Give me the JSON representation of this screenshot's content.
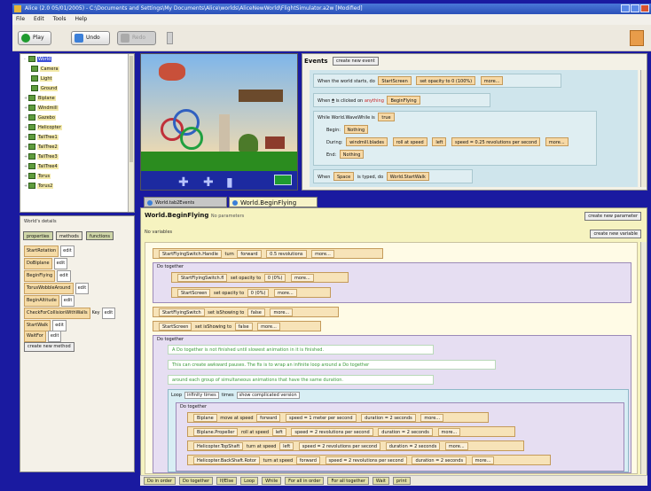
{
  "window": {
    "title": "Alice (2.0 05/01/2005) - C:\\Documents and Settings\\My Documents\\Alice\\worlds\\AliceNewWorld\\FlightSimulator.a2w [Modified]"
  },
  "menu": [
    "File",
    "Edit",
    "Tools",
    "Help"
  ],
  "toolbar": {
    "play": "Play",
    "undo": "Undo",
    "redo": "Redo"
  },
  "tree": [
    {
      "label": "World",
      "selected": true
    },
    {
      "label": "Camera"
    },
    {
      "label": "Light"
    },
    {
      "label": "Ground"
    },
    {
      "label": "Biplane"
    },
    {
      "label": "Windmill"
    },
    {
      "label": "Gazebo"
    },
    {
      "label": "Helicopter"
    },
    {
      "label": "TallTree1"
    },
    {
      "label": "TallTree2"
    },
    {
      "label": "TallTree3"
    },
    {
      "label": "TallTree4"
    },
    {
      "label": "Torus"
    },
    {
      "label": "Torus2"
    }
  ],
  "details": {
    "title": "World's details",
    "tabs": [
      "properties",
      "methods",
      "functions"
    ],
    "methods": [
      {
        "name": "StartRotation",
        "edit": "edit"
      },
      {
        "name": "DoBiplane",
        "edit": "edit"
      },
      {
        "name": "BeginFlying",
        "edit": "edit"
      },
      {
        "name": "TorusWobbleAround",
        "edit": "edit"
      },
      {
        "name": "BeginAltitude",
        "edit": "edit"
      },
      {
        "name": "CheckForCollisionWithWalls",
        "param": "Key",
        "edit": "edit"
      },
      {
        "name": "StartWalk",
        "edit": "edit"
      },
      {
        "name": "WaitFor",
        "edit": "edit"
      }
    ],
    "create_method": "create new method"
  },
  "events": {
    "title": "Events",
    "create_event": "create new event",
    "rows": [
      {
        "prefix": "When the world starts, do",
        "chips": [
          "StartScreen",
          "set opacity to 0 (100%)",
          "more..."
        ]
      },
      {
        "prefix": "When",
        "mid": "is clicked on",
        "hl": "anything",
        "chips": [
          "BeginFlying"
        ]
      },
      {
        "prefix": "While",
        "mid": "World.WaveWhile is",
        "chips": [
          "true"
        ]
      },
      {
        "prefix": "Begin:",
        "chips": [
          "Nothing"
        ]
      },
      {
        "prefix": "During:",
        "chips": [
          "windmill.blades",
          "roll at speed",
          "left",
          "speed = 0.25 revolutions per second",
          "more..."
        ]
      },
      {
        "prefix": "End:",
        "chips": [
          "Nothing"
        ]
      },
      {
        "prefix": "When",
        "mid": "is typed, do",
        "chips": [
          "Space",
          "World.StartWalk"
        ]
      }
    ]
  },
  "editor_tabs": [
    {
      "label": "World.tab2Events"
    },
    {
      "label": "World.BeginFlying",
      "active": true
    }
  ],
  "editor": {
    "method_title": "World.BeginFlying",
    "method_sub": "No parameters",
    "no_vars": "No variables",
    "create_param": "create new parameter",
    "create_var": "create new variable",
    "statements": [
      {
        "parts": [
          "StartFlyingSwitch.Handle",
          "turn",
          "forward",
          "0.5 revolutions",
          "more..."
        ]
      }
    ],
    "do_together_1": {
      "label": "Do together",
      "rows": [
        [
          "StartFlyingSwitch.fl",
          "set opacity to",
          "0 (0%)",
          "more..."
        ],
        [
          "StartScreen",
          "set opacity to",
          "0 (0%)",
          "more..."
        ]
      ]
    },
    "after_rows": [
      [
        "StartFlyingSwitch",
        "set isShowing to",
        "false",
        "more..."
      ],
      [
        "StartScreen",
        "set isShowing to",
        "false",
        "more..."
      ]
    ],
    "do_together_2": {
      "label": "Do together",
      "comments": [
        "A Do together is not finished until slowest animation in it is finished.",
        "This can create awkward pauses. The fix is to wrap an infinite loop around a Do together",
        "around each group of simultaneous animations that have the same duration."
      ],
      "loop": {
        "label": "Loop",
        "count": "infinity times",
        "times": "times",
        "show": "show complicated version",
        "inner_label": "Do together",
        "rows": [
          [
            "Biplane",
            "move at speed",
            "forward",
            "speed = 1 meter per second",
            "duration = 2 seconds",
            "more..."
          ],
          [
            "Biplane.Propeller",
            "roll at speed",
            "left",
            "speed = 2 revolutions per second",
            "duration = 2 seconds",
            "more..."
          ],
          [
            "Helicopter.TopShaft",
            "turn at speed",
            "left",
            "speed = 2 revolutions per second",
            "duration = 2 seconds",
            "more..."
          ],
          [
            "Helicopter.BackShaft.Rotor",
            "turn at speed",
            "forward",
            "speed = 2 revolutions per second",
            "duration = 2 seconds",
            "more..."
          ]
        ]
      }
    }
  },
  "bottom_bar": [
    "Do in order",
    "Do together",
    "If/Else",
    "Loop",
    "While",
    "For all in order",
    "For all together",
    "Wait",
    "print"
  ],
  "colors": {
    "background": "#1a1aa0",
    "titlebar": "#2a50b8",
    "editor_bg": "#f6f3c0",
    "events_bg": "#cfe5ec"
  }
}
